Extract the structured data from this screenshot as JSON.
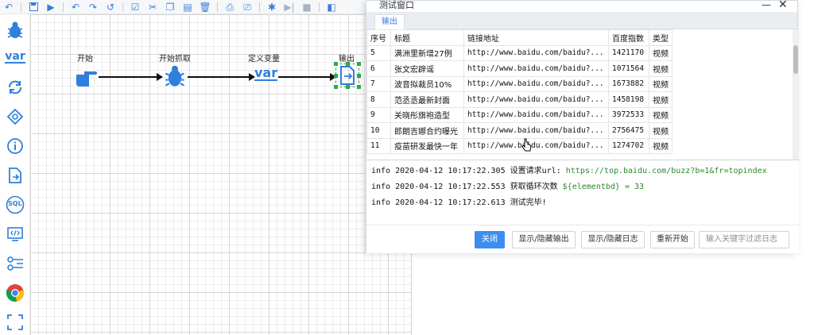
{
  "toolbar": {
    "icons": [
      "undo-icon",
      "save-icon",
      "run-icon",
      "undo2-icon",
      "redo-icon",
      "history-icon",
      "select-icon",
      "cut-icon",
      "copy-icon",
      "delete-icon",
      "import-icon",
      "print-icon",
      "debug-icon",
      "step-icon",
      "stop-icon",
      "panel-icon"
    ]
  },
  "sidebar": {
    "items": [
      "bug-icon",
      "var-icon",
      "loop-icon",
      "condition-icon",
      "info-icon",
      "file-export-icon",
      "sql-icon",
      "code-icon",
      "settings-flow-icon",
      "chrome-icon",
      "fullscreen-icon"
    ],
    "var_text": "var",
    "sql_text": "SQL"
  },
  "canvas": {
    "nodes": [
      {
        "label": "开始",
        "icon": "pointing-hand-icon"
      },
      {
        "label": "开始抓取",
        "icon": "bug-icon"
      },
      {
        "label": "定义变量",
        "icon": "var-icon",
        "icon_text": "var"
      },
      {
        "label": "输出",
        "icon": "output-document-icon"
      }
    ]
  },
  "dialog": {
    "title": "测试窗口",
    "minimize": "—",
    "close": "✕",
    "tab": "输出",
    "columns": [
      "序号",
      "标题",
      "链接地址",
      "百度指数",
      "类型"
    ],
    "rows": [
      [
        "5",
        "满洲里新增27例",
        "http://www.baidu.com/baidu?...",
        "1421170",
        "视频"
      ],
      [
        "6",
        "张文宏辟谣",
        "http://www.baidu.com/baidu?...",
        "1071564",
        "视频"
      ],
      [
        "7",
        "波音拟裁员10%",
        "http://www.baidu.com/baidu?...",
        "1673882",
        "视频"
      ],
      [
        "8",
        "范丞丞最新封面",
        "http://www.baidu.com/baidu?...",
        "1458198",
        "视频"
      ],
      [
        "9",
        "关晓彤旗袍造型",
        "http://www.baidu.com/baidu?...",
        "3972533",
        "视频"
      ],
      [
        "10",
        "郎朗吉娜合约曝光",
        "http://www.baidu.com/baidu?...",
        "2756475",
        "视频"
      ],
      [
        "11",
        "疫苗研发最快一年",
        "http://www.baidu.com/baidu?...",
        "1274702",
        "视频"
      ]
    ],
    "log": [
      {
        "level": "info",
        "time": "2020-04-12 10:17:22.305",
        "msg": "设置请求url:",
        "value": "https://top.baidu.com/buzz?b=1&fr=topindex"
      },
      {
        "level": "info",
        "time": "2020-04-12 10:17:22.553",
        "msg": "获取循环次数",
        "value": "${elementbd} = 33"
      },
      {
        "level": "info",
        "time": "2020-04-12 10:17:22.613",
        "msg": "测试完毕!",
        "value": ""
      }
    ],
    "buttons": {
      "close": "关闭",
      "toggle_output": "显示/隐藏输出",
      "toggle_log": "显示/隐藏日志",
      "restart": "重新开始",
      "filter_placeholder": "输入关键字过滤日志"
    }
  }
}
